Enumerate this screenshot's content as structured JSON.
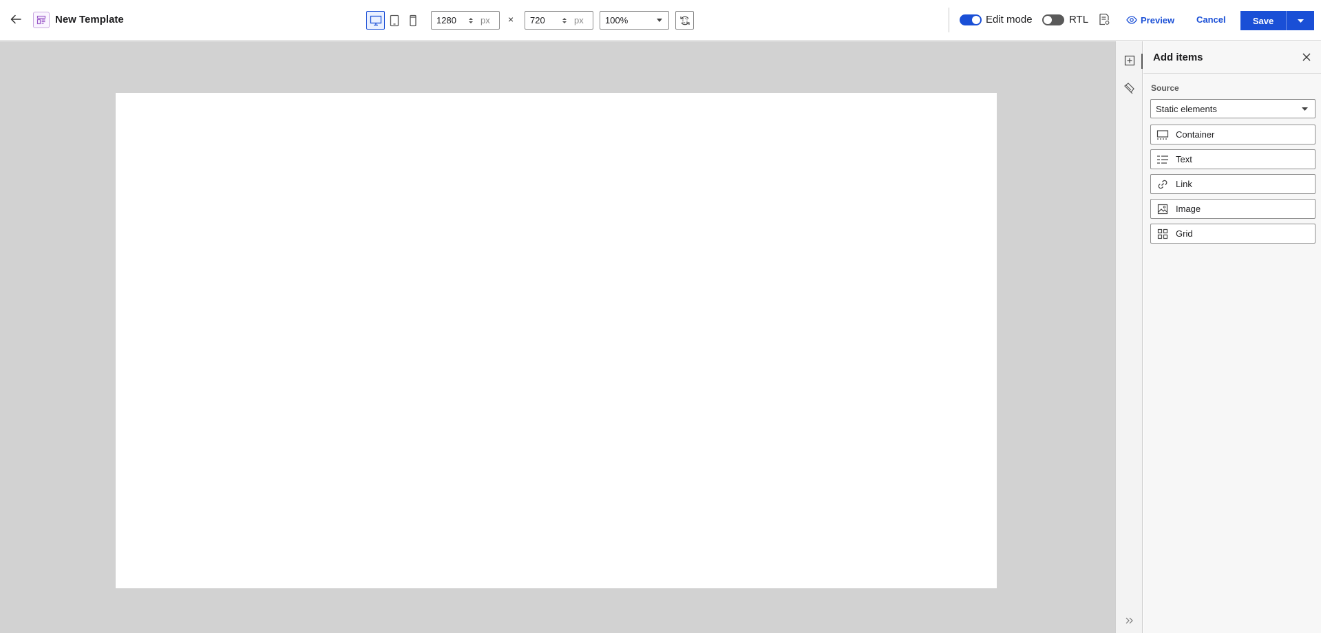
{
  "header": {
    "title": "New Template",
    "width_value": "1280",
    "width_unit": "px",
    "times": "×",
    "height_value": "720",
    "height_unit": "px",
    "zoom": "100%",
    "edit_mode_label": "Edit mode",
    "edit_mode_on": true,
    "rtl_label": "RTL",
    "rtl_on": false,
    "preview_label": "Preview",
    "cancel_label": "Cancel",
    "save_label": "Save"
  },
  "colors": {
    "accent": "#1a4fd6",
    "canvas_background": "#d2d2d2",
    "template_icon": "#9b59c7"
  },
  "panel": {
    "title": "Add items",
    "source_label": "Source",
    "source_value": "Static elements",
    "items": [
      {
        "label": "Container",
        "icon": "container-icon"
      },
      {
        "label": "Text",
        "icon": "text-icon"
      },
      {
        "label": "Link",
        "icon": "link-icon"
      },
      {
        "label": "Image",
        "icon": "image-icon"
      },
      {
        "label": "Grid",
        "icon": "grid-icon"
      }
    ]
  }
}
